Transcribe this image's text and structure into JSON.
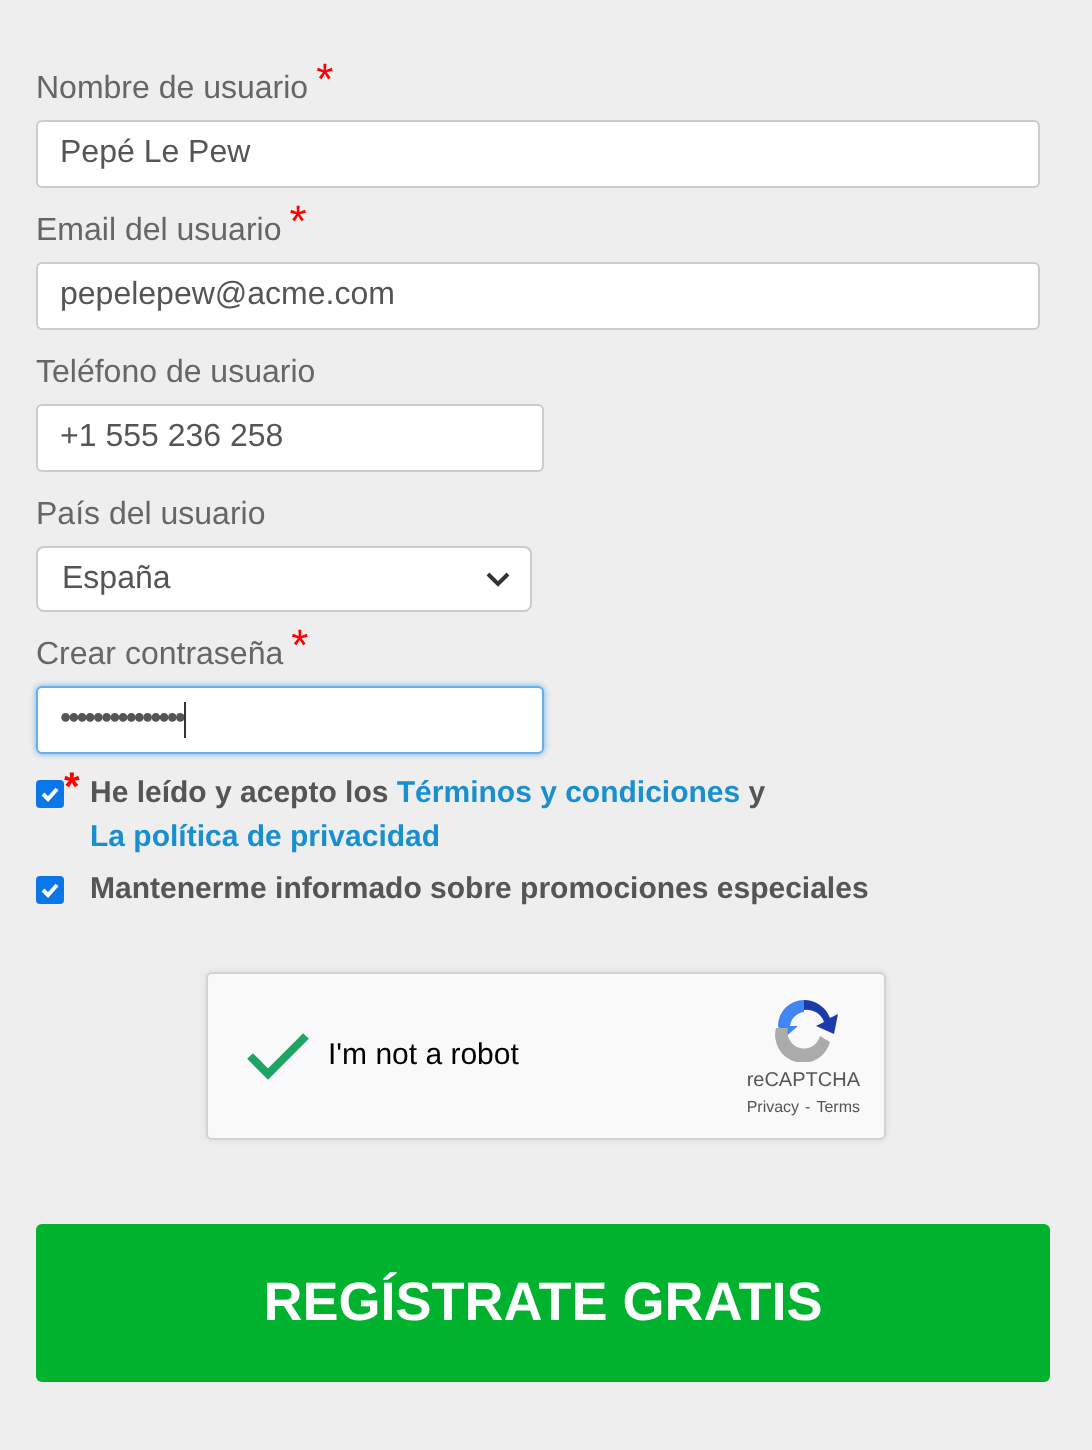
{
  "fields": [
    {
      "kind": "text",
      "label": "Nombre de usuario",
      "required_mark": "*",
      "wide": true,
      "value": "Pepé Le Pew",
      "focused": false
    },
    {
      "kind": "text",
      "label": "Email del usuario",
      "required_mark": "*",
      "wide": true,
      "value": "pepelepew@acme.com",
      "focused": false
    },
    {
      "kind": "text",
      "label": "Teléfono de usuario",
      "wide": false,
      "value": "+1 555 236 258",
      "focused": false
    },
    {
      "kind": "select",
      "label": "País del usuario",
      "wide": false,
      "value": "España",
      "focused": false
    },
    {
      "kind": "password",
      "label": "Crear contraseña",
      "required_mark": "*",
      "wide": false,
      "value": "•••••••••••••••",
      "focused": true
    }
  ],
  "consents": [
    {
      "checked": true,
      "required_mark": "*",
      "text": "He leído y acepto los",
      "link1": "Términos y condiciones",
      "joiner": "y",
      "link2": "La política de privacidad"
    },
    {
      "checked": true,
      "text": "Mantenerme informado sobre promociones especiales"
    }
  ],
  "captcha": {
    "checked": true,
    "label": "I'm not a robot",
    "brand": "reCAPTCHA",
    "privacy": "Privacy",
    "separator": "-",
    "terms": "Terms"
  },
  "submit": "REGÍSTRATE GRATIS"
}
